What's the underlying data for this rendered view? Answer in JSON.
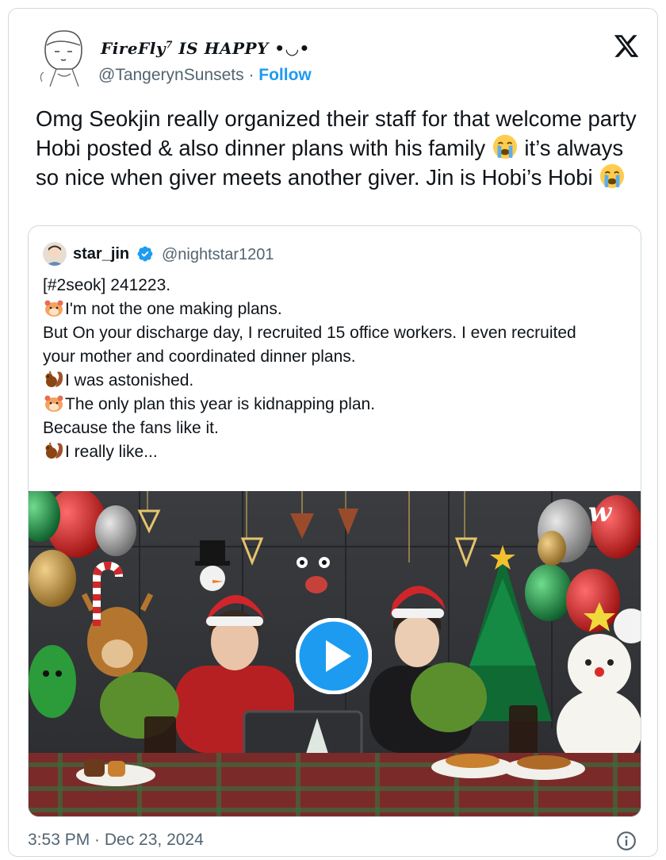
{
  "author": {
    "name": "FireFly",
    "name_sup": "7",
    "name_rest": " IS HAPPY •◡•",
    "handle": "@TangerynSunsets",
    "separator": "·",
    "follow_label": "Follow",
    "avatar_icon": "sketch-face-avatar"
  },
  "platform_icon": "x-logo-icon",
  "tweet": {
    "text_part1": "Omg Seokjin really organized their staff for that welcome party Hobi posted & also dinner plans with his family ",
    "text_part2": " it’s always so nice when giver meets another giver. Jin is Hobi’s Hobi ",
    "emoji": "loudly-crying-face-icon"
  },
  "quoted": {
    "name": "star_jin",
    "handle": "@nightstar1201",
    "verified_icon": "verified-badge-icon",
    "lines": [
      {
        "emoji": "",
        "text": "[#2seok] 241223."
      },
      {
        "emoji": "hamster-icon",
        "text": "I'm not the one making plans."
      },
      {
        "emoji": "",
        "text": "But On your discharge day, I recruited 15 office workers. I even recruited"
      },
      {
        "emoji": "",
        "text": "your mother and coordinated dinner plans."
      },
      {
        "emoji": "squirrel-icon",
        "text": "I was astonished."
      },
      {
        "emoji": "hamster-icon",
        "text": "The only plan this year is kidnapping plan."
      },
      {
        "emoji": "",
        "text": "Because the fans like it."
      },
      {
        "emoji": "squirrel-icon",
        "text": "I really like..."
      }
    ],
    "media": {
      "watermark": "w",
      "play_icon": "play-button-icon"
    }
  },
  "footer": {
    "timestamp": "3:53 PM · Dec 23, 2024",
    "info_icon": "info-icon"
  },
  "colors": {
    "follow": "#1d9bf0",
    "secondary_text": "#536471",
    "border": "#cfd9de",
    "verified": "#1d9bf0"
  }
}
